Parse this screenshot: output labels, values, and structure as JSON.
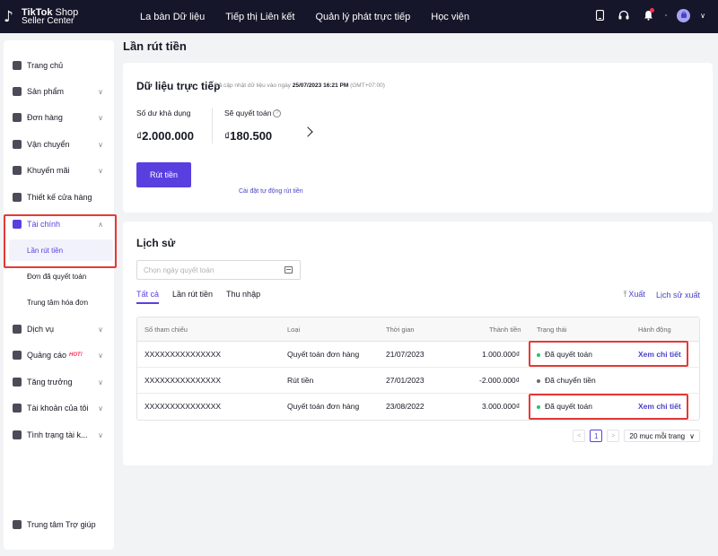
{
  "brand": {
    "name_bold": "TikTok",
    "name_rest": " Shop",
    "subtitle": "Seller Center"
  },
  "topnav": [
    "La bàn Dữ liệu",
    "Tiếp thị Liên kết",
    "Quản lý phát trực tiếp",
    "Học viện"
  ],
  "top_icons": [
    "phone-icon",
    "headset-icon",
    "bell-icon",
    "avatar-icon"
  ],
  "sidebar": {
    "items": [
      {
        "label": "Trang chủ",
        "icon": "home-icon"
      },
      {
        "label": "Sản phẩm",
        "icon": "product-icon",
        "chevron": "∨"
      },
      {
        "label": "Đơn hàng",
        "icon": "order-icon",
        "chevron": "∨"
      },
      {
        "label": "Vận chuyển",
        "icon": "truck-icon",
        "chevron": "∨"
      },
      {
        "label": "Khuyến mãi",
        "icon": "megaphone-icon",
        "chevron": "∨"
      },
      {
        "label": "Thiết kế cửa hàng",
        "icon": "store-icon"
      },
      {
        "label": "Tài chính",
        "icon": "card-icon",
        "chevron": "∧"
      },
      {
        "label": "Dịch vụ",
        "icon": "globe-icon",
        "chevron": "∨"
      },
      {
        "label": "Quảng cáo",
        "icon": "ads-icon",
        "hot": "HOT!",
        "chevron": "∨"
      },
      {
        "label": "Tăng trưởng",
        "icon": "growth-icon",
        "chevron": "∨"
      },
      {
        "label": "Tài khoản của tôi",
        "icon": "account-icon",
        "chevron": "∨"
      },
      {
        "label": "Tình trạng tài k...",
        "icon": "shield-icon",
        "chevron": "∨"
      }
    ],
    "sub_items": [
      "Lần rút tiền",
      "Đơn đã quyết toán",
      "Trung tâm hóa đơn"
    ],
    "help": "Trung tâm Trợ giúp"
  },
  "page_title": "Lần rút tiền",
  "live": {
    "title": "Dữ liệu trực tiếp",
    "updated_prefix": "Đã cập nhật dữ liệu vào ngày ",
    "updated_time": "25/07/2023 16:21 PM",
    "updated_tz": " (GMT+07:00)",
    "available_label": "Số dư khả dụng",
    "available_currency": "₫",
    "available_value": "2.000.000",
    "settle_label": "Sẽ quyết toán",
    "settle_currency": "₫",
    "settle_value": "180.500",
    "withdraw_button": "Rút tiền",
    "auto_link": "Cài đặt tự động rút tiền"
  },
  "history": {
    "title": "Lịch sử",
    "date_placeholder": "Chọn ngày quyết toán",
    "tabs": [
      "Tất cả",
      "Lần rút tiền",
      "Thu nhập"
    ],
    "export": "Xuất",
    "export_history": "Lịch sử xuất",
    "columns": [
      "Số tham chiếu",
      "Loại",
      "Thời gian",
      "Thành tiền",
      "Trạng thái",
      "Hành động"
    ],
    "rows": [
      {
        "ref": "XXXXXXXXXXXXXXX",
        "type": "Quyết toán đơn hàng",
        "time": "21/07/2023",
        "amount": "1.000.000₫",
        "status": "Đã quyết toán",
        "status_color": "#25c26e",
        "action": "Xem chi tiết"
      },
      {
        "ref": "XXXXXXXXXXXXXXX",
        "type": "Rút tiền",
        "time": "27/01/2023",
        "amount": "-2.000.000₫",
        "status": "Đã chuyển tiền",
        "status_color": "#6b6c72",
        "action": ""
      },
      {
        "ref": "XXXXXXXXXXXXXXX",
        "type": "Quyết toán đơn hàng",
        "time": "23/08/2022",
        "amount": "3.000.000₫",
        "status": "Đã quyết toán",
        "status_color": "#25c26e",
        "action": "Xem chi tiết"
      }
    ],
    "pagination": {
      "prev": "<",
      "current": "1",
      "next": ">",
      "page_size": "20 mục mỗi trang"
    }
  },
  "colors": {
    "primary": "#5a3fe0",
    "topbar": "#16162a",
    "highlight": "#e53935"
  }
}
